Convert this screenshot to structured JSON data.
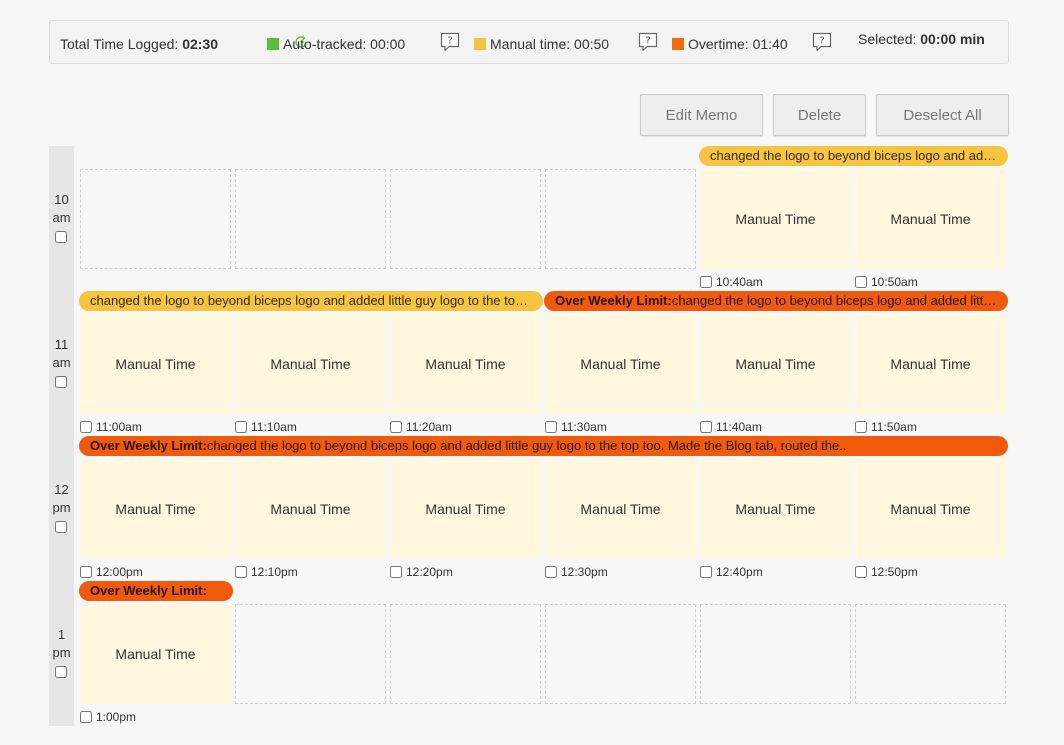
{
  "summary": {
    "total_label": "Total Time Logged:",
    "total_value": "02:30",
    "auto_label": "Auto-tracked: 00:00",
    "manual_label": "Manual time: 00:50",
    "overtime_label": "Overtime: 01:40",
    "selected_label": "Selected:",
    "selected_value": "00:00 min"
  },
  "colors": {
    "auto": "#5fbf3a",
    "manual": "#f5c542",
    "overtime": "#f26b0f",
    "cell": "#fff8df"
  },
  "toolbar": {
    "edit_memo": "Edit Memo",
    "delete": "Delete",
    "deselect_all": "Deselect All"
  },
  "hours": [
    {
      "num": "10",
      "ampm": "am"
    },
    {
      "num": "11",
      "ampm": "am"
    },
    {
      "num": "12",
      "ampm": "pm"
    },
    {
      "num": "1",
      "ampm": "pm"
    }
  ],
  "rows": [
    {
      "memos": [
        {
          "type": "manual",
          "prefix": "",
          "text": "changed the logo to beyond biceps logo and added little guy logo to the top too."
        }
      ],
      "slots": [
        {
          "filled": false,
          "time": ""
        },
        {
          "filled": false,
          "time": ""
        },
        {
          "filled": false,
          "time": ""
        },
        {
          "filled": false,
          "time": ""
        },
        {
          "filled": true,
          "label": "Manual Time",
          "time": "10:40am"
        },
        {
          "filled": true,
          "label": "Manual Time",
          "time": "10:50am"
        }
      ]
    },
    {
      "memos": [
        {
          "type": "manual",
          "prefix": "",
          "text": "changed the logo to beyond biceps logo and added little guy logo to the top too."
        },
        {
          "type": "over",
          "prefix": "Over Weekly Limit:",
          "text": "changed the logo to beyond biceps logo and added little guy logo to the top too."
        }
      ],
      "slots": [
        {
          "filled": true,
          "label": "Manual Time",
          "time": "11:00am"
        },
        {
          "filled": true,
          "label": "Manual Time",
          "time": "11:10am"
        },
        {
          "filled": true,
          "label": "Manual Time",
          "time": "11:20am"
        },
        {
          "filled": true,
          "label": "Manual Time",
          "time": "11:30am"
        },
        {
          "filled": true,
          "label": "Manual Time",
          "time": "11:40am"
        },
        {
          "filled": true,
          "label": "Manual Time",
          "time": "11:50am"
        }
      ]
    },
    {
      "memos": [
        {
          "type": "over",
          "prefix": "Over Weekly Limit:",
          "text": "changed the logo to beyond biceps logo and added little guy logo to the top too. Made the Blog tab, routed the.."
        }
      ],
      "slots": [
        {
          "filled": true,
          "label": "Manual Time",
          "time": "12:00pm"
        },
        {
          "filled": true,
          "label": "Manual Time",
          "time": "12:10pm"
        },
        {
          "filled": true,
          "label": "Manual Time",
          "time": "12:20pm"
        },
        {
          "filled": true,
          "label": "Manual Time",
          "time": "12:30pm"
        },
        {
          "filled": true,
          "label": "Manual Time",
          "time": "12:40pm"
        },
        {
          "filled": true,
          "label": "Manual Time",
          "time": "12:50pm"
        }
      ]
    },
    {
      "memos": [
        {
          "type": "over",
          "prefix": "Over Weekly Limit:",
          "text": ""
        }
      ],
      "slots": [
        {
          "filled": true,
          "label": "Manual Time",
          "time": "1:00pm"
        },
        {
          "filled": false,
          "time": ""
        },
        {
          "filled": false,
          "time": ""
        },
        {
          "filled": false,
          "time": ""
        },
        {
          "filled": false,
          "time": ""
        },
        {
          "filled": false,
          "time": ""
        }
      ]
    }
  ]
}
